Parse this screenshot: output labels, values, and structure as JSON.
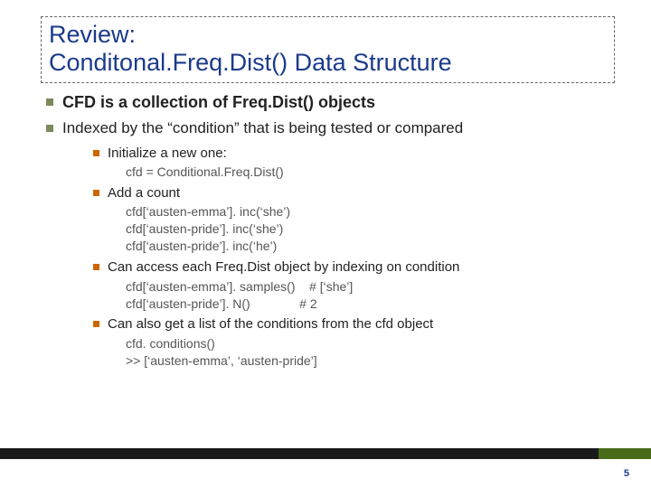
{
  "title": {
    "line1": "Review:",
    "line2": "Conditonal.Freq.Dist() Data Structure"
  },
  "bullets": [
    {
      "text": "CFD is a collection of Freq.Dist() objects",
      "strong": true
    },
    {
      "text": "Indexed by the “condition” that is being tested or compared",
      "strong": false,
      "children": [
        {
          "title": "Initialize a new one:",
          "code": [
            "cfd = Conditional.Freq.Dist()"
          ]
        },
        {
          "title": "Add a count",
          "code": [
            "cfd[‘austen-emma’]. inc(‘she’)",
            "cfd[‘austen-pride’]. inc(‘she’)",
            "cfd[‘austen-pride’]. inc(‘he’)"
          ]
        },
        {
          "title": "Can access each Freq.Dist object by indexing on condition",
          "code": [
            "cfd[‘austen-emma’]. samples()    # [‘she’]",
            "cfd[‘austen-pride’]. N()              # 2"
          ]
        },
        {
          "title": "Can also get a list of the conditions from the cfd object",
          "code": [
            "cfd. conditions()",
            ">> [‘austen-emma’, ‘austen-pride’]"
          ]
        }
      ]
    }
  ],
  "page_number": "5"
}
